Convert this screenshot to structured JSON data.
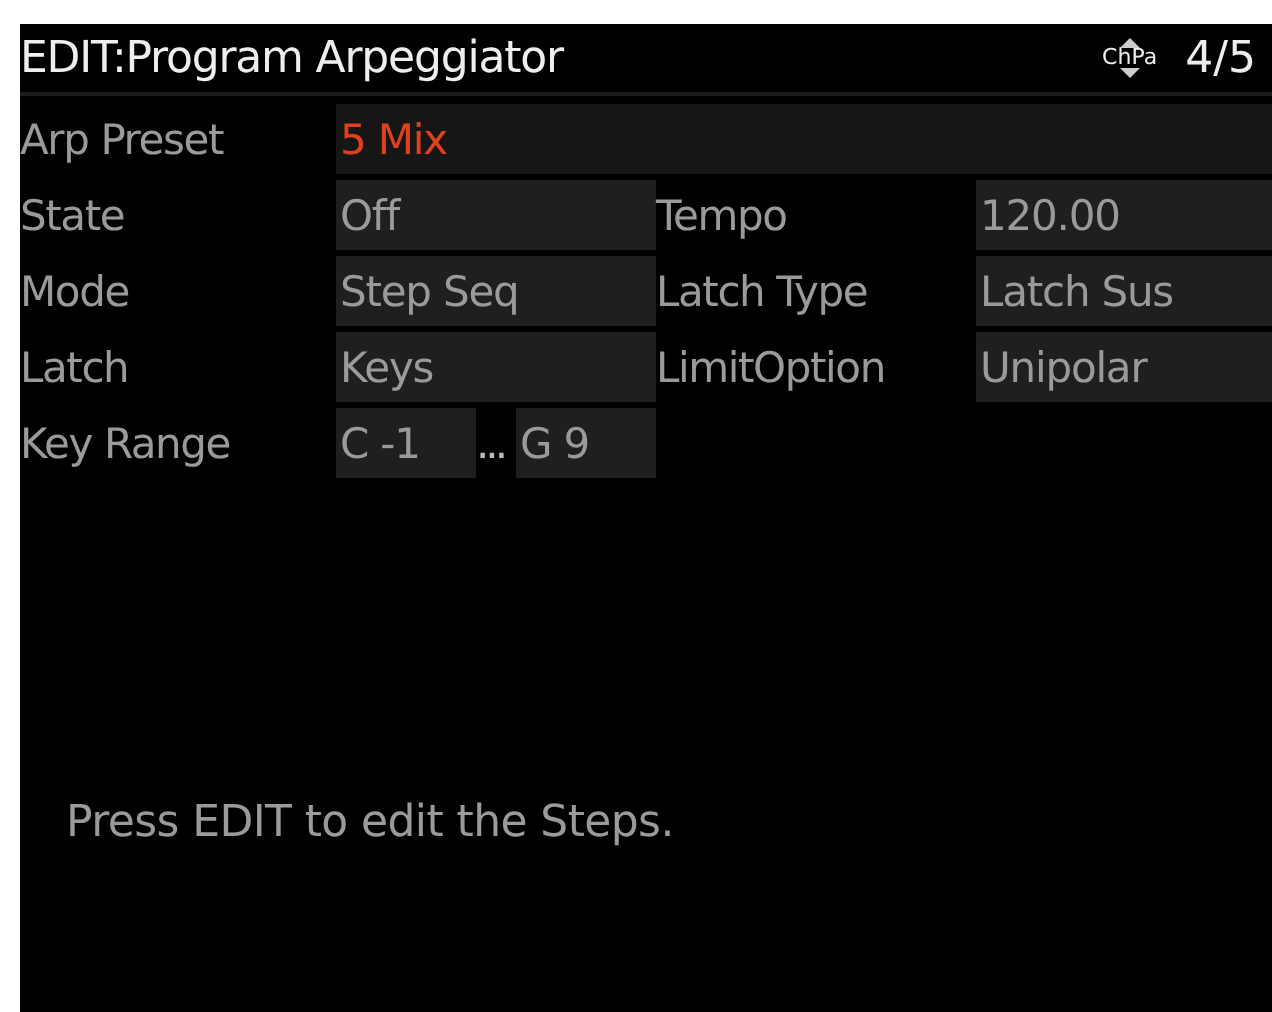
{
  "title": "EDIT:Program Arpeggiator",
  "nav_label": "ChPa",
  "page_indicator": "4/5",
  "preset": {
    "label": "Arp Preset",
    "value": "5 Mix"
  },
  "params": [
    [
      {
        "label": "State",
        "value": "Off"
      },
      {
        "label": "Tempo",
        "value": "120.00"
      }
    ],
    [
      {
        "label": "Mode",
        "value": "Step Seq"
      },
      {
        "label": "Latch Type",
        "value": "Latch Sus"
      }
    ],
    [
      {
        "label": "Latch",
        "value": "Keys"
      },
      {
        "label": "LimitOption",
        "value": "Unipolar"
      }
    ]
  ],
  "key_range": {
    "label": "Key Range",
    "low": "C -1",
    "separator": "...",
    "high": "G 9"
  },
  "message": "Press EDIT to edit the Steps."
}
